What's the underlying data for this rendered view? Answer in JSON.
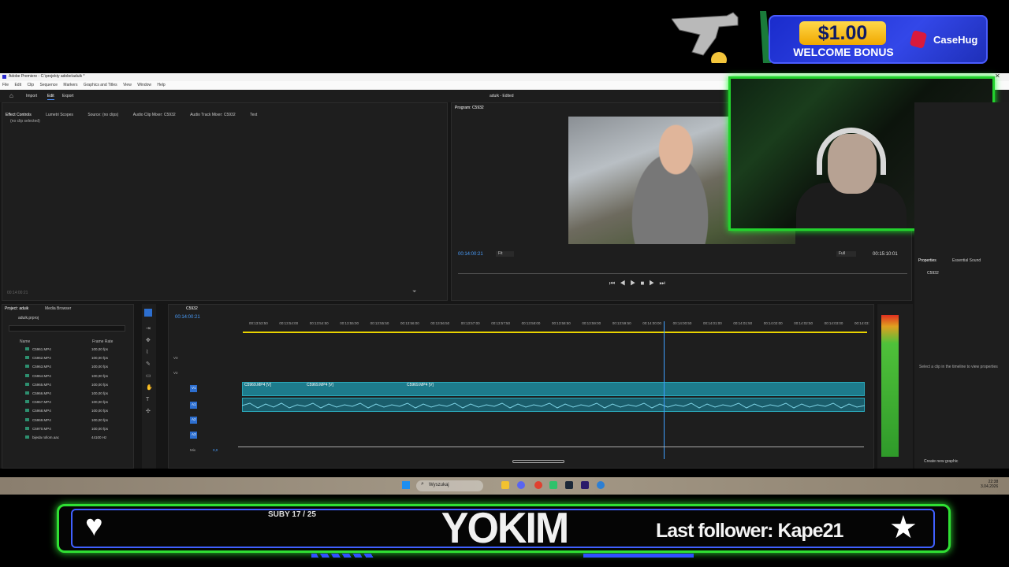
{
  "promo": {
    "amount": "$1.00",
    "bonus": "WELCOME BONUS",
    "brand": "CaseHug"
  },
  "window": {
    "title": "Adobe Premiere - C:\\projekty adobe\\aduik *",
    "menu": [
      "File",
      "Edit",
      "Clip",
      "Sequence",
      "Markers",
      "Graphics and Titles",
      "View",
      "Window",
      "Help"
    ]
  },
  "header": {
    "workspaces": [
      "Import",
      "Edit",
      "Export"
    ],
    "doc_title": "aduik - Edited"
  },
  "effect_panel": {
    "tabs": [
      "Effect Controls",
      "Lumetri Scopes",
      "Source: (no clips)",
      "Audio Clip Mixer: C5932",
      "Audio Track Mixer: C5932",
      "Text"
    ],
    "empty_msg": "(no clip selected)",
    "timecode": "00:14:00:21"
  },
  "program_panel": {
    "title": "Program: C5932",
    "timecode_left": "00:14:00:21",
    "fit": "Fit",
    "full": "Full",
    "timecode_right": "00:15:10:01"
  },
  "properties": {
    "tabs": [
      "Properties",
      "Essential Sound"
    ],
    "item": "C5932",
    "hint": "Select a clip in the timeline to view properties",
    "create_btn": "Create new graphic"
  },
  "project": {
    "tabs": [
      "Project: aduik",
      "Media Browser"
    ],
    "file": "aduik.prproj",
    "col_name": "Name",
    "col_rate": "Frame Rate",
    "files": [
      {
        "name": "C5961.MP4",
        "rate": "100,00 fps"
      },
      {
        "name": "C5962.MP4",
        "rate": "100,00 fps"
      },
      {
        "name": "C5963.MP4",
        "rate": "100,00 fps"
      },
      {
        "name": "C5964.MP4",
        "rate": "100,00 fps"
      },
      {
        "name": "C5965.MP4",
        "rate": "100,00 fps"
      },
      {
        "name": "C5966.MP4",
        "rate": "100,00 fps"
      },
      {
        "name": "C5967.MP4",
        "rate": "100,00 fps"
      },
      {
        "name": "C5968.MP4",
        "rate": "100,00 fps"
      },
      {
        "name": "C5969.MP4",
        "rate": "100,00 fps"
      },
      {
        "name": "C5970.MP4",
        "rate": "100,00 fps"
      },
      {
        "name": "bijeda rollom.aac",
        "rate": "44100 Hz"
      }
    ]
  },
  "timeline": {
    "seq_tab": "C5932",
    "timecode": "00:14:00:21",
    "ticks": [
      "00:13:53:50",
      "00:13:54:00",
      "00:13:54:50",
      "00:13:55:00",
      "00:13:55:50",
      "00:13:56:00",
      "00:13:56:50",
      "00:13:57:00",
      "00:13:57:50",
      "00:13:58:00",
      "00:13:58:50",
      "00:13:59:00",
      "00:13:59:50",
      "00:14:00:00",
      "00:14:00:50",
      "00:14:01:00",
      "00:14:01:50",
      "00:14:02:00",
      "00:14:02:50",
      "00:14:03:00",
      "00:14:03:"
    ],
    "tracks": [
      "V3",
      "V2",
      "V1",
      "A1",
      "A2",
      "A3",
      "Mix"
    ],
    "mix_val": "0,0",
    "clips": [
      "C5969.MP4 [V]",
      "C5969.MP4 [V]",
      "C5969.MP4 [V]"
    ]
  },
  "taskbar": {
    "search": "Wyszukaj",
    "time": "22:38",
    "date": "3.04.2026"
  },
  "overlay": {
    "subs": "SUBY 17 / 25",
    "name": "YOKIM",
    "last_follower": "Last follower: Kape21"
  }
}
